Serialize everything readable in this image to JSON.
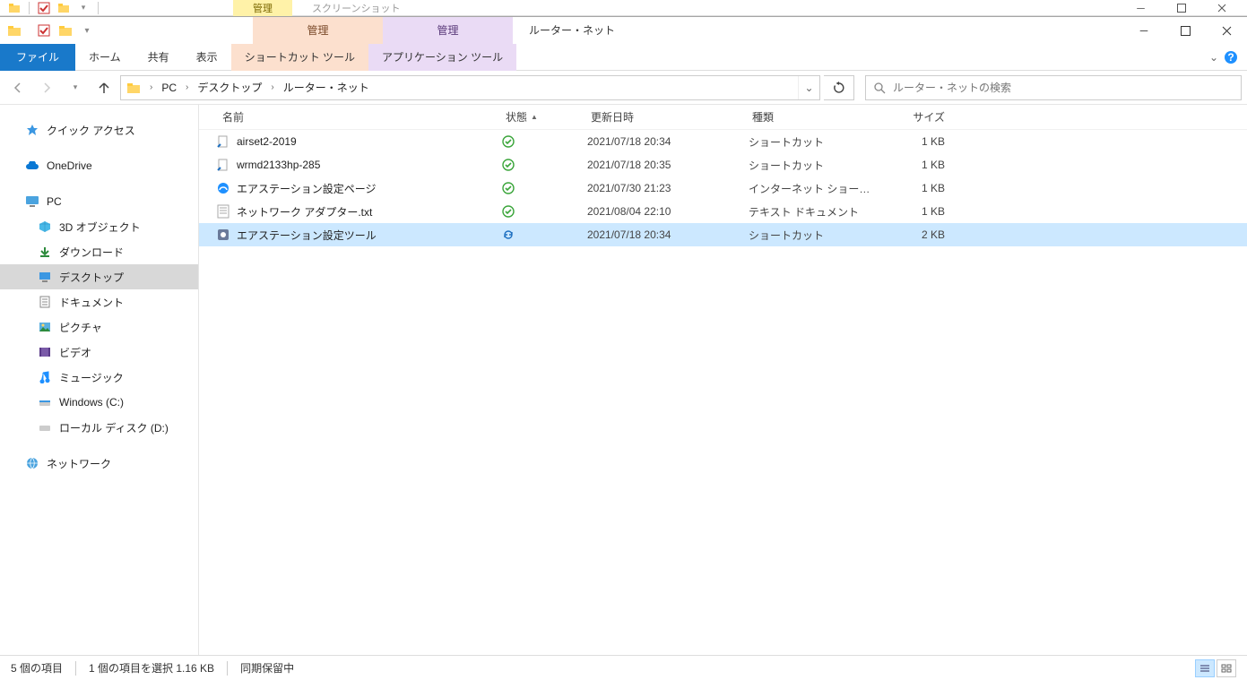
{
  "bg_window": {
    "tab_manage": "管理",
    "tab_screenshot": "スクリーンショット"
  },
  "window": {
    "title": "ルーター・ネット",
    "ctx_tab1_title": "管理",
    "ctx_tab2_title": "管理"
  },
  "tabs": {
    "file": "ファイル",
    "home": "ホーム",
    "share": "共有",
    "view": "表示",
    "ctx1": "ショートカット ツール",
    "ctx2": "アプリケーション ツール"
  },
  "breadcrumb": {
    "seg0": "PC",
    "seg1": "デスクトップ",
    "seg2": "ルーター・ネット"
  },
  "search": {
    "placeholder": "ルーター・ネットの検索"
  },
  "sidebar": {
    "quick": "クイック アクセス",
    "onedrive": "OneDrive",
    "pc": "PC",
    "pc_items": {
      "objects3d": "3D オブジェクト",
      "downloads": "ダウンロード",
      "desktop": "デスクトップ",
      "documents": "ドキュメント",
      "pictures": "ピクチャ",
      "videos": "ビデオ",
      "music": "ミュージック",
      "drive_c": "Windows (C:)",
      "drive_d": "ローカル ディスク (D:)"
    },
    "network": "ネットワーク"
  },
  "columns": {
    "name": "名前",
    "status": "状態",
    "modified": "更新日時",
    "type": "種類",
    "size": "サイズ"
  },
  "files": [
    {
      "name": "airset2-2019",
      "status": "ok",
      "date": "2021/07/18 20:34",
      "type": "ショートカット",
      "size": "1 KB"
    },
    {
      "name": "wrmd2133hp-285",
      "status": "ok",
      "date": "2021/07/18 20:35",
      "type": "ショートカット",
      "size": "1 KB"
    },
    {
      "name": "エアステーション設定ページ",
      "status": "ok",
      "date": "2021/07/30 21:23",
      "type": "インターネット ショート...",
      "size": "1 KB"
    },
    {
      "name": "ネットワーク アダプター.txt",
      "status": "ok",
      "date": "2021/08/04 22:10",
      "type": "テキスト ドキュメント",
      "size": "1 KB"
    },
    {
      "name": "エアステーション設定ツール",
      "status": "sync",
      "date": "2021/07/18 20:34",
      "type": "ショートカット",
      "size": "2 KB"
    }
  ],
  "selected_index": 4,
  "statusbar": {
    "count": "5 個の項目",
    "selection": "1 個の項目を選択 1.16 KB",
    "sync": "同期保留中"
  }
}
